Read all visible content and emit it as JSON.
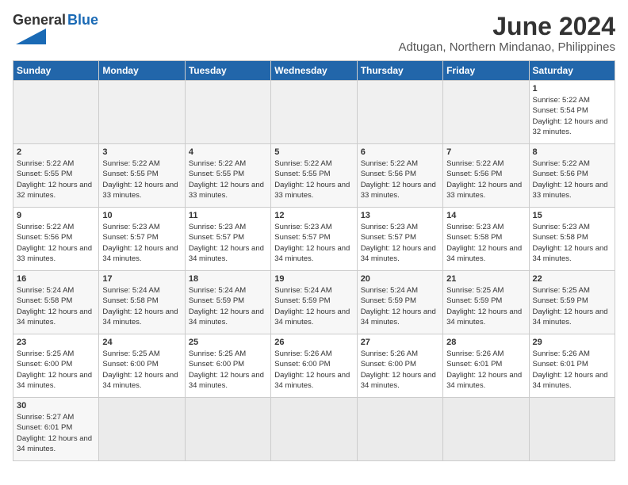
{
  "logo": {
    "text_general": "General",
    "text_blue": "Blue"
  },
  "title": "June 2024",
  "subtitle": "Adtugan, Northern Mindanao, Philippines",
  "headers": [
    "Sunday",
    "Monday",
    "Tuesday",
    "Wednesday",
    "Thursday",
    "Friday",
    "Saturday"
  ],
  "weeks": [
    [
      {
        "day": "",
        "sunrise": "",
        "sunset": "",
        "daylight": "",
        "empty": true
      },
      {
        "day": "",
        "sunrise": "",
        "sunset": "",
        "daylight": "",
        "empty": true
      },
      {
        "day": "",
        "sunrise": "",
        "sunset": "",
        "daylight": "",
        "empty": true
      },
      {
        "day": "",
        "sunrise": "",
        "sunset": "",
        "daylight": "",
        "empty": true
      },
      {
        "day": "",
        "sunrise": "",
        "sunset": "",
        "daylight": "",
        "empty": true
      },
      {
        "day": "",
        "sunrise": "",
        "sunset": "",
        "daylight": "",
        "empty": true
      },
      {
        "day": "1",
        "sunrise": "Sunrise: 5:22 AM",
        "sunset": "Sunset: 5:54 PM",
        "daylight": "Daylight: 12 hours and 32 minutes.",
        "empty": false
      }
    ],
    [
      {
        "day": "2",
        "sunrise": "Sunrise: 5:22 AM",
        "sunset": "Sunset: 5:55 PM",
        "daylight": "Daylight: 12 hours and 32 minutes.",
        "empty": false
      },
      {
        "day": "3",
        "sunrise": "Sunrise: 5:22 AM",
        "sunset": "Sunset: 5:55 PM",
        "daylight": "Daylight: 12 hours and 33 minutes.",
        "empty": false
      },
      {
        "day": "4",
        "sunrise": "Sunrise: 5:22 AM",
        "sunset": "Sunset: 5:55 PM",
        "daylight": "Daylight: 12 hours and 33 minutes.",
        "empty": false
      },
      {
        "day": "5",
        "sunrise": "Sunrise: 5:22 AM",
        "sunset": "Sunset: 5:55 PM",
        "daylight": "Daylight: 12 hours and 33 minutes.",
        "empty": false
      },
      {
        "day": "6",
        "sunrise": "Sunrise: 5:22 AM",
        "sunset": "Sunset: 5:56 PM",
        "daylight": "Daylight: 12 hours and 33 minutes.",
        "empty": false
      },
      {
        "day": "7",
        "sunrise": "Sunrise: 5:22 AM",
        "sunset": "Sunset: 5:56 PM",
        "daylight": "Daylight: 12 hours and 33 minutes.",
        "empty": false
      },
      {
        "day": "8",
        "sunrise": "Sunrise: 5:22 AM",
        "sunset": "Sunset: 5:56 PM",
        "daylight": "Daylight: 12 hours and 33 minutes.",
        "empty": false
      }
    ],
    [
      {
        "day": "9",
        "sunrise": "Sunrise: 5:22 AM",
        "sunset": "Sunset: 5:56 PM",
        "daylight": "Daylight: 12 hours and 33 minutes.",
        "empty": false
      },
      {
        "day": "10",
        "sunrise": "Sunrise: 5:23 AM",
        "sunset": "Sunset: 5:57 PM",
        "daylight": "Daylight: 12 hours and 34 minutes.",
        "empty": false
      },
      {
        "day": "11",
        "sunrise": "Sunrise: 5:23 AM",
        "sunset": "Sunset: 5:57 PM",
        "daylight": "Daylight: 12 hours and 34 minutes.",
        "empty": false
      },
      {
        "day": "12",
        "sunrise": "Sunrise: 5:23 AM",
        "sunset": "Sunset: 5:57 PM",
        "daylight": "Daylight: 12 hours and 34 minutes.",
        "empty": false
      },
      {
        "day": "13",
        "sunrise": "Sunrise: 5:23 AM",
        "sunset": "Sunset: 5:57 PM",
        "daylight": "Daylight: 12 hours and 34 minutes.",
        "empty": false
      },
      {
        "day": "14",
        "sunrise": "Sunrise: 5:23 AM",
        "sunset": "Sunset: 5:58 PM",
        "daylight": "Daylight: 12 hours and 34 minutes.",
        "empty": false
      },
      {
        "day": "15",
        "sunrise": "Sunrise: 5:23 AM",
        "sunset": "Sunset: 5:58 PM",
        "daylight": "Daylight: 12 hours and 34 minutes.",
        "empty": false
      }
    ],
    [
      {
        "day": "16",
        "sunrise": "Sunrise: 5:24 AM",
        "sunset": "Sunset: 5:58 PM",
        "daylight": "Daylight: 12 hours and 34 minutes.",
        "empty": false
      },
      {
        "day": "17",
        "sunrise": "Sunrise: 5:24 AM",
        "sunset": "Sunset: 5:58 PM",
        "daylight": "Daylight: 12 hours and 34 minutes.",
        "empty": false
      },
      {
        "day": "18",
        "sunrise": "Sunrise: 5:24 AM",
        "sunset": "Sunset: 5:59 PM",
        "daylight": "Daylight: 12 hours and 34 minutes.",
        "empty": false
      },
      {
        "day": "19",
        "sunrise": "Sunrise: 5:24 AM",
        "sunset": "Sunset: 5:59 PM",
        "daylight": "Daylight: 12 hours and 34 minutes.",
        "empty": false
      },
      {
        "day": "20",
        "sunrise": "Sunrise: 5:24 AM",
        "sunset": "Sunset: 5:59 PM",
        "daylight": "Daylight: 12 hours and 34 minutes.",
        "empty": false
      },
      {
        "day": "21",
        "sunrise": "Sunrise: 5:25 AM",
        "sunset": "Sunset: 5:59 PM",
        "daylight": "Daylight: 12 hours and 34 minutes.",
        "empty": false
      },
      {
        "day": "22",
        "sunrise": "Sunrise: 5:25 AM",
        "sunset": "Sunset: 5:59 PM",
        "daylight": "Daylight: 12 hours and 34 minutes.",
        "empty": false
      }
    ],
    [
      {
        "day": "23",
        "sunrise": "Sunrise: 5:25 AM",
        "sunset": "Sunset: 6:00 PM",
        "daylight": "Daylight: 12 hours and 34 minutes.",
        "empty": false
      },
      {
        "day": "24",
        "sunrise": "Sunrise: 5:25 AM",
        "sunset": "Sunset: 6:00 PM",
        "daylight": "Daylight: 12 hours and 34 minutes.",
        "empty": false
      },
      {
        "day": "25",
        "sunrise": "Sunrise: 5:25 AM",
        "sunset": "Sunset: 6:00 PM",
        "daylight": "Daylight: 12 hours and 34 minutes.",
        "empty": false
      },
      {
        "day": "26",
        "sunrise": "Sunrise: 5:26 AM",
        "sunset": "Sunset: 6:00 PM",
        "daylight": "Daylight: 12 hours and 34 minutes.",
        "empty": false
      },
      {
        "day": "27",
        "sunrise": "Sunrise: 5:26 AM",
        "sunset": "Sunset: 6:00 PM",
        "daylight": "Daylight: 12 hours and 34 minutes.",
        "empty": false
      },
      {
        "day": "28",
        "sunrise": "Sunrise: 5:26 AM",
        "sunset": "Sunset: 6:01 PM",
        "daylight": "Daylight: 12 hours and 34 minutes.",
        "empty": false
      },
      {
        "day": "29",
        "sunrise": "Sunrise: 5:26 AM",
        "sunset": "Sunset: 6:01 PM",
        "daylight": "Daylight: 12 hours and 34 minutes.",
        "empty": false
      }
    ],
    [
      {
        "day": "30",
        "sunrise": "Sunrise: 5:27 AM",
        "sunset": "Sunset: 6:01 PM",
        "daylight": "Daylight: 12 hours and 34 minutes.",
        "empty": false
      },
      {
        "day": "",
        "sunrise": "",
        "sunset": "",
        "daylight": "",
        "empty": true
      },
      {
        "day": "",
        "sunrise": "",
        "sunset": "",
        "daylight": "",
        "empty": true
      },
      {
        "day": "",
        "sunrise": "",
        "sunset": "",
        "daylight": "",
        "empty": true
      },
      {
        "day": "",
        "sunrise": "",
        "sunset": "",
        "daylight": "",
        "empty": true
      },
      {
        "day": "",
        "sunrise": "",
        "sunset": "",
        "daylight": "",
        "empty": true
      },
      {
        "day": "",
        "sunrise": "",
        "sunset": "",
        "daylight": "",
        "empty": true
      }
    ]
  ]
}
